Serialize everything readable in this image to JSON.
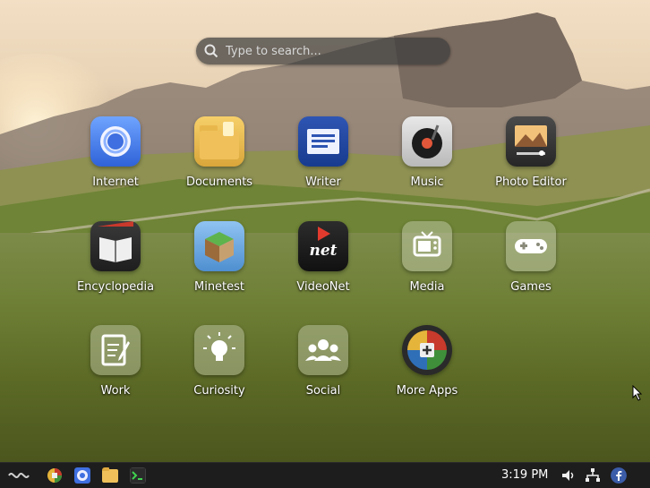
{
  "search": {
    "placeholder": "Type to search..."
  },
  "apps": [
    {
      "label": "Internet",
      "icon": "chromium-icon"
    },
    {
      "label": "Documents",
      "icon": "folder-icon"
    },
    {
      "label": "Writer",
      "icon": "writer-icon"
    },
    {
      "label": "Music",
      "icon": "music-record-icon"
    },
    {
      "label": "Photo Editor",
      "icon": "photo-editor-icon"
    },
    {
      "label": "Encyclopedia",
      "icon": "encyclopedia-book-icon"
    },
    {
      "label": "Minetest",
      "icon": "minetest-block-icon"
    },
    {
      "label": "VideoNet",
      "icon": "videonet-icon"
    },
    {
      "label": "Media",
      "icon": "tv-icon"
    },
    {
      "label": "Games",
      "icon": "gamepad-icon"
    },
    {
      "label": "Work",
      "icon": "document-pencil-icon"
    },
    {
      "label": "Curiosity",
      "icon": "lightbulb-icon"
    },
    {
      "label": "Social",
      "icon": "people-icon"
    },
    {
      "label": "More Apps",
      "icon": "app-store-icon"
    }
  ],
  "taskbar": {
    "clock": "3:19 PM",
    "icons": [
      "show-desktop-icon",
      "app-store-icon",
      "chromium-icon",
      "files-icon",
      "terminal-icon",
      "volume-icon",
      "network-icon",
      "facebook-icon"
    ]
  }
}
